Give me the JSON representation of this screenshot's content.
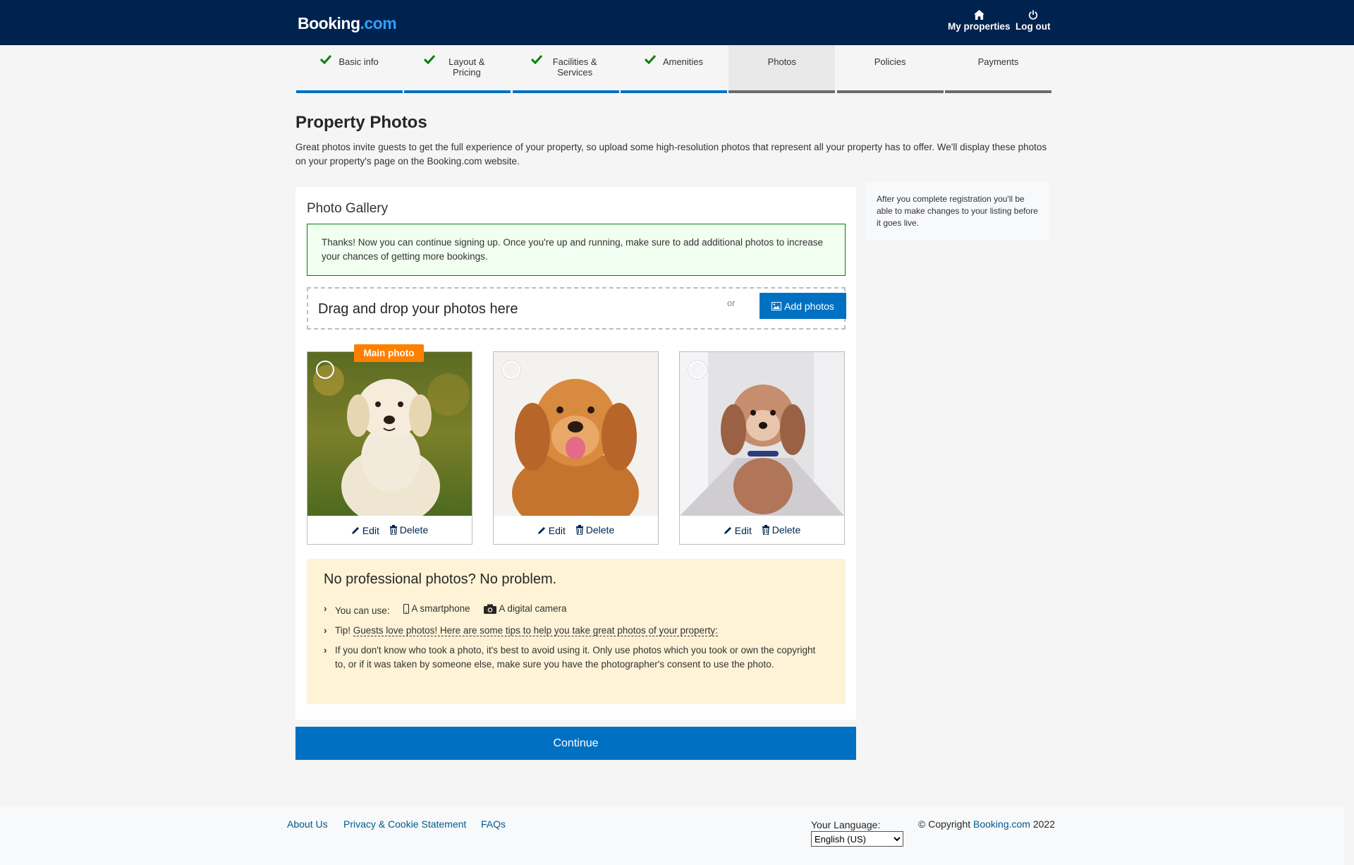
{
  "header": {
    "logo_main": "Booking",
    "logo_suffix": ".com",
    "my_properties": "My properties",
    "log_out": "Log out"
  },
  "steps": [
    {
      "label": "Basic info",
      "status": "done"
    },
    {
      "label": "Layout & Pricing",
      "status": "done"
    },
    {
      "label": "Facilities & Services",
      "status": "done"
    },
    {
      "label": "Amenities",
      "status": "done"
    },
    {
      "label": "Photos",
      "status": "active"
    },
    {
      "label": "Policies",
      "status": "todo"
    },
    {
      "label": "Payments",
      "status": "todo"
    }
  ],
  "page": {
    "title": "Property Photos",
    "description": "Great photos invite guests to get the full experience of your property, so upload some high-resolution photos that represent all your property has to offer. We'll display these photos on your property's page on the Booking.com website."
  },
  "gallery": {
    "title": "Photo Gallery",
    "success_message": "Thanks! Now you can continue signing up. Once you're up and running, make sure to add additional photos to increase your chances of getting more bookings.",
    "drop_text": "Drag and drop your photos here",
    "or_text": "or",
    "add_photos": "Add photos",
    "main_photo_badge": "Main photo",
    "edit_label": "Edit",
    "delete_label": "Delete"
  },
  "tips": {
    "heading": "No professional photos? No problem.",
    "you_can_use": "You can use:",
    "smartphone": "A smartphone",
    "camera": "A digital camera",
    "tip_prefix": "Tip!",
    "tip_link": "Guests love photos! Here are some tips to help you take great photos of your property:",
    "copyright_note": "If you don't know who took a photo, it's best to avoid using it. Only use photos which you took or own the copyright to, or if it was taken by someone else, make sure you have the photographer's consent to use the photo."
  },
  "continue_label": "Continue",
  "side_note": "After you complete registration you'll be able to make changes to your listing before it goes live.",
  "footer": {
    "about": "About Us",
    "privacy": "Privacy & Cookie Statement",
    "faqs": "FAQs",
    "language_label": "Your Language:",
    "language_value": "English (US)",
    "copyright_prefix": "© Copyright",
    "copyright_brand": "Booking.com",
    "copyright_year": "2022"
  },
  "colors": {
    "header_bg": "#00224f",
    "primary": "#0071c2",
    "badge": "#ff8000",
    "success_border": "#008009"
  }
}
